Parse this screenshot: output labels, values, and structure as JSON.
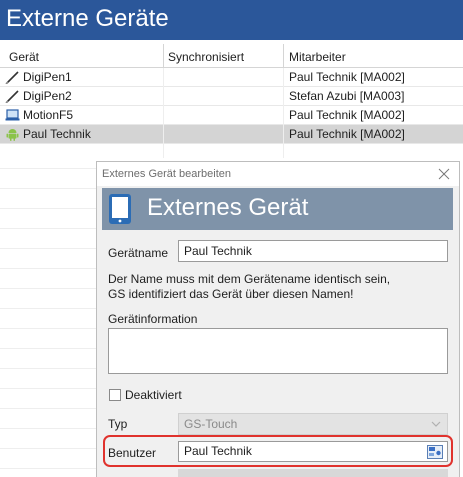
{
  "banner": {
    "title": "Externe Geräte"
  },
  "table": {
    "columns": [
      "Gerät",
      "Synchronisiert",
      "Mitarbeiter"
    ],
    "rows": [
      {
        "icon": "pen-icon",
        "name": "DigiPen1",
        "synced": "",
        "employee": "Paul Technik [MA002]"
      },
      {
        "icon": "pen-icon",
        "name": "DigiPen2",
        "synced": "",
        "employee": "Stefan Azubi [MA003]"
      },
      {
        "icon": "laptop-icon",
        "name": "MotionF5",
        "synced": "",
        "employee": "Paul Technik [MA002]"
      },
      {
        "icon": "android-icon",
        "name": "Paul Technik",
        "synced": "",
        "employee": "Paul Technik [MA002]",
        "selected": true
      }
    ]
  },
  "dialog": {
    "window_title": "Externes Gerät bearbeiten",
    "header_title": "Externes Gerät",
    "name_label": "Gerätname",
    "name_value": "Paul Technik",
    "note_line1": "Der Name muss mit dem Gerätename identisch sein,",
    "note_line2": "GS identifiziert das Gerät über diesen Namen!",
    "info_label": "Gerätinformation",
    "info_value": "",
    "deactivated_label": "Deaktiviert",
    "deactivated_checked": false,
    "type_label": "Typ",
    "type_value": "GS-Touch",
    "user_label": "Benutzer",
    "user_value": "Paul Technik"
  },
  "colors": {
    "banner": "#2b579a",
    "dialog_header": "#7f93a9",
    "highlight": "#e0322d",
    "selected_row": "#d4d4d4"
  }
}
